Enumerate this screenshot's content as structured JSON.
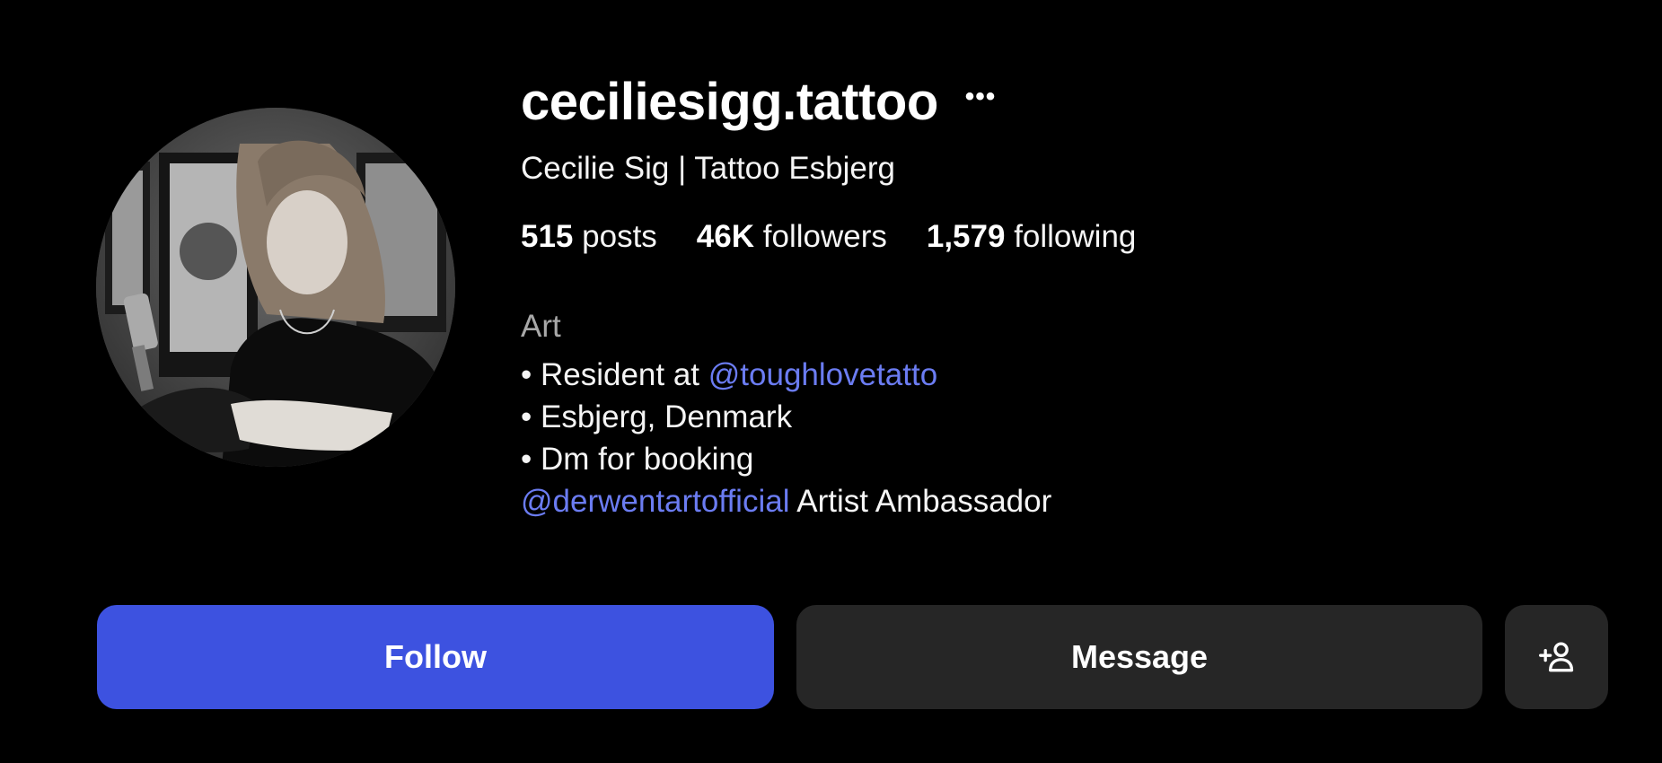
{
  "profile": {
    "username": "ceciliesigg.tattoo",
    "full_name": "Cecilie Sig | Tattoo Esbjerg",
    "avatar_icon": "profile-photo",
    "more_icon": "more-options-icon"
  },
  "stats": {
    "posts": {
      "count": "515",
      "label": "posts"
    },
    "followers": {
      "count": "46K",
      "label": "followers"
    },
    "following": {
      "count": "1,579",
      "label": "following"
    }
  },
  "category": "Art",
  "bio": {
    "line1_prefix": "• Resident at ",
    "line1_mention": "@toughlovetatto",
    "line2": "• Esbjerg, Denmark",
    "line3": "• Dm for booking",
    "line4_mention": "@derwentartofficial",
    "line4_suffix": " Artist Ambassador"
  },
  "actions": {
    "follow_label": "Follow",
    "message_label": "Message",
    "add_icon": "add-person-icon"
  },
  "colors": {
    "background": "#000000",
    "follow_button": "#3d52e0",
    "secondary_button": "#262626",
    "mention_link": "#6b7cf2",
    "category_text": "#a8a8a8"
  }
}
